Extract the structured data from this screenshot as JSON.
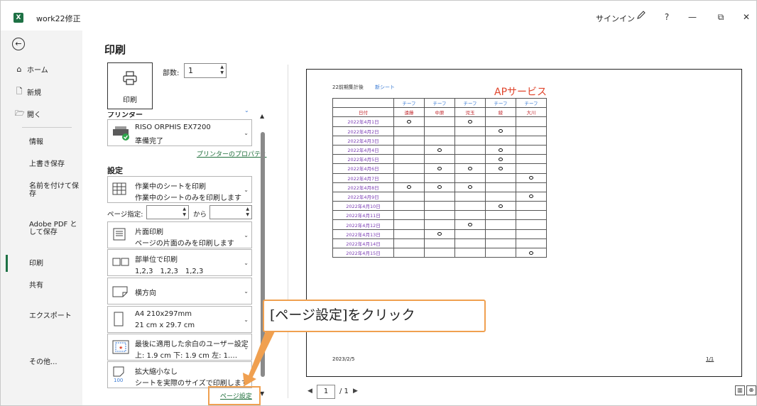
{
  "titlebar": {
    "app_icon": "X",
    "doc_title": "work22修正",
    "signin": "サインイン",
    "icons": [
      "pen-icon",
      "help-icon",
      "minimize-icon",
      "restore-icon",
      "close-icon"
    ],
    "help": "?",
    "minimize": "—",
    "restore": "⧉",
    "close": "✕"
  },
  "nav": {
    "back": "←",
    "home": "ホーム",
    "new": "新規",
    "open": "開く",
    "info": "情報",
    "save": "上書き保存",
    "save_as": "名前を付けて保存",
    "adobe_pdf": "Adobe PDF として保存",
    "print": "印刷",
    "share": "共有",
    "export": "エクスポート",
    "more": "その他..."
  },
  "print_panel": {
    "title": "印刷",
    "print_button": "印刷",
    "copies_label": "部数:",
    "copies_value": "1",
    "printer_header": "プリンター",
    "printer_name": "RISO ORPHIS EX7200",
    "printer_status": "準備完了",
    "printer_props_link": "プリンターのプロパティ",
    "settings_header": "設定",
    "scope_main": "作業中のシートを印刷",
    "scope_sub": "作業中のシートのみを印刷します",
    "pages_label": "ページ指定:",
    "pages_to": "から",
    "sides_main": "片面印刷",
    "sides_sub": "ページの片面のみを印刷します",
    "collate_main": "部単位で印刷",
    "collate_sub": "1,2,3　1,2,3　1,2,3",
    "orientation": "横方向",
    "paper_main": "A4 210x297mm",
    "paper_sub": "21 cm x 29.7 cm",
    "margin_main": "最後に適用した余白のユーザー設定",
    "margin_sub": "上: 1.9 cm 下: 1.9 cm 左: 1.…",
    "scale_main": "拡大縮小なし",
    "scale_sub": "シートを実際のサイズで印刷します",
    "page_setup_link": "ページ設定"
  },
  "preview": {
    "header_left": "22前期集計後",
    "header_link": "新シート",
    "company": "APサービス",
    "team_label": "チーフ",
    "date_header": "日付",
    "members": [
      "遠藤",
      "中原",
      "児玉",
      "綾",
      "大川"
    ],
    "dates": [
      "2022年4月1日",
      "2022年4月2日",
      "2022年4月3日",
      "2022年4月4日",
      "2022年4月5日",
      "2022年4月6日",
      "2022年4月7日",
      "2022年4月8日",
      "2022年4月9日",
      "2022年4月10日",
      "2022年4月11日",
      "2022年4月12日",
      "2022年4月13日",
      "2022年4月14日",
      "2022年4月15日"
    ],
    "marks": [
      [
        0,
        2
      ],
      [
        3
      ],
      [],
      [
        1,
        3
      ],
      [
        3
      ],
      [
        1,
        2,
        3
      ],
      [
        4
      ],
      [
        0,
        1,
        2
      ],
      [
        4
      ],
      [
        3
      ],
      [],
      [
        2
      ],
      [
        1
      ],
      [],
      [
        4
      ]
    ],
    "footer_date": "2023/2/5",
    "footer_page": "1/1"
  },
  "pager": {
    "prev": "◀",
    "current": "1",
    "total": "/ 1",
    "next": "▶"
  },
  "annotation": {
    "callout": "[ページ設定]をクリック",
    "color": "#f0a050"
  }
}
